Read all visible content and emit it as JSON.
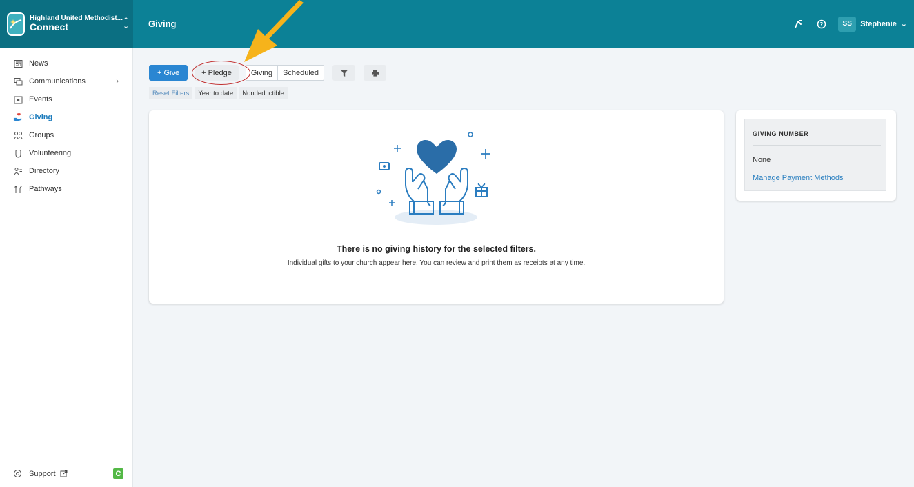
{
  "topbar": {
    "org_name": "Highland United Methodist...",
    "app_name": "Connect",
    "page_title": "Giving",
    "user_initials": "SS",
    "user_name": "Stephenie"
  },
  "sidebar": {
    "items": [
      {
        "label": "News",
        "icon": "news-icon"
      },
      {
        "label": "Communications",
        "icon": "communications-icon"
      },
      {
        "label": "Events",
        "icon": "events-icon"
      },
      {
        "label": "Giving",
        "icon": "giving-icon"
      },
      {
        "label": "Groups",
        "icon": "groups-icon"
      },
      {
        "label": "Volunteering",
        "icon": "volunteering-icon"
      },
      {
        "label": "Directory",
        "icon": "directory-icon"
      },
      {
        "label": "Pathways",
        "icon": "pathways-icon"
      }
    ],
    "support_label": "Support",
    "support_badge": "C"
  },
  "toolbar": {
    "give_label": "+ Give",
    "pledge_label": "+ Pledge",
    "tab_giving": "Giving",
    "tab_scheduled": "Scheduled"
  },
  "filters": {
    "reset": "Reset Filters",
    "year": "Year to date",
    "nondeductible": "Nondeductible"
  },
  "empty_state": {
    "title": "There is no giving history for the selected filters.",
    "description": "Individual gifts to your church appear here. You can review and print them as receipts at any time."
  },
  "giving_number": {
    "title": "GIVING NUMBER",
    "value": "None",
    "link": "Manage Payment Methods"
  },
  "colors": {
    "topbar": "#0c8196",
    "primary": "#2a86d2",
    "active_nav": "#1d7cbd",
    "annotation_arrow": "#f6b31b",
    "annotation_circle": "#c02a2a"
  }
}
